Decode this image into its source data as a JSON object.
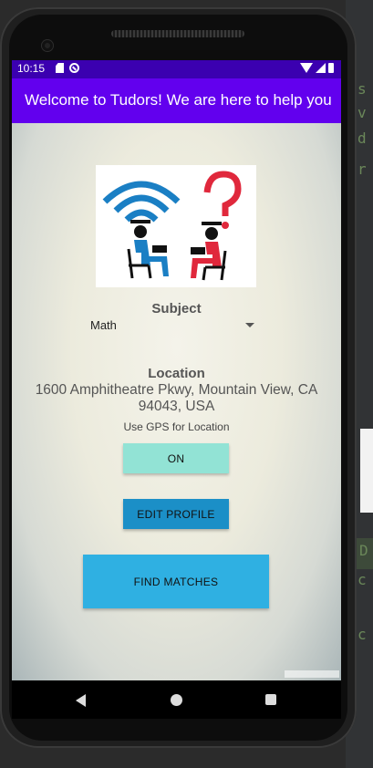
{
  "status_bar": {
    "time": "10:15",
    "icons_left": [
      "sd-card-icon",
      "do-not-disturb-icon"
    ],
    "icons_right": [
      "wifi-icon",
      "signal-icon",
      "battery-icon"
    ]
  },
  "app_bar": {
    "title": "Welcome to Tudors! We are here to help you"
  },
  "logo": {
    "description_icon": "tutoring-logo-icon",
    "colors": {
      "left": "#1a7fc4",
      "right": "#e0283c"
    }
  },
  "subject": {
    "label": "Subject",
    "selected": "Math"
  },
  "location": {
    "label": "Location",
    "address": "1600 Amphitheatre Pkwy, Mountain View, CA 94043, USA",
    "gps_label": "Use GPS for Location",
    "gps_toggle_label": "ON"
  },
  "buttons": {
    "edit_profile": "EDIT PROFILE",
    "find_matches": "FIND MATCHES"
  },
  "colors": {
    "status_bar": "#3b00b0",
    "app_bar": "#6200ee",
    "gps_toggle": "#92e3d5",
    "edit_profile": "#1b8fc7",
    "find_matches": "#2fb0e2"
  },
  "nav": {
    "icons": [
      "back-icon",
      "home-icon",
      "recents-icon"
    ]
  }
}
